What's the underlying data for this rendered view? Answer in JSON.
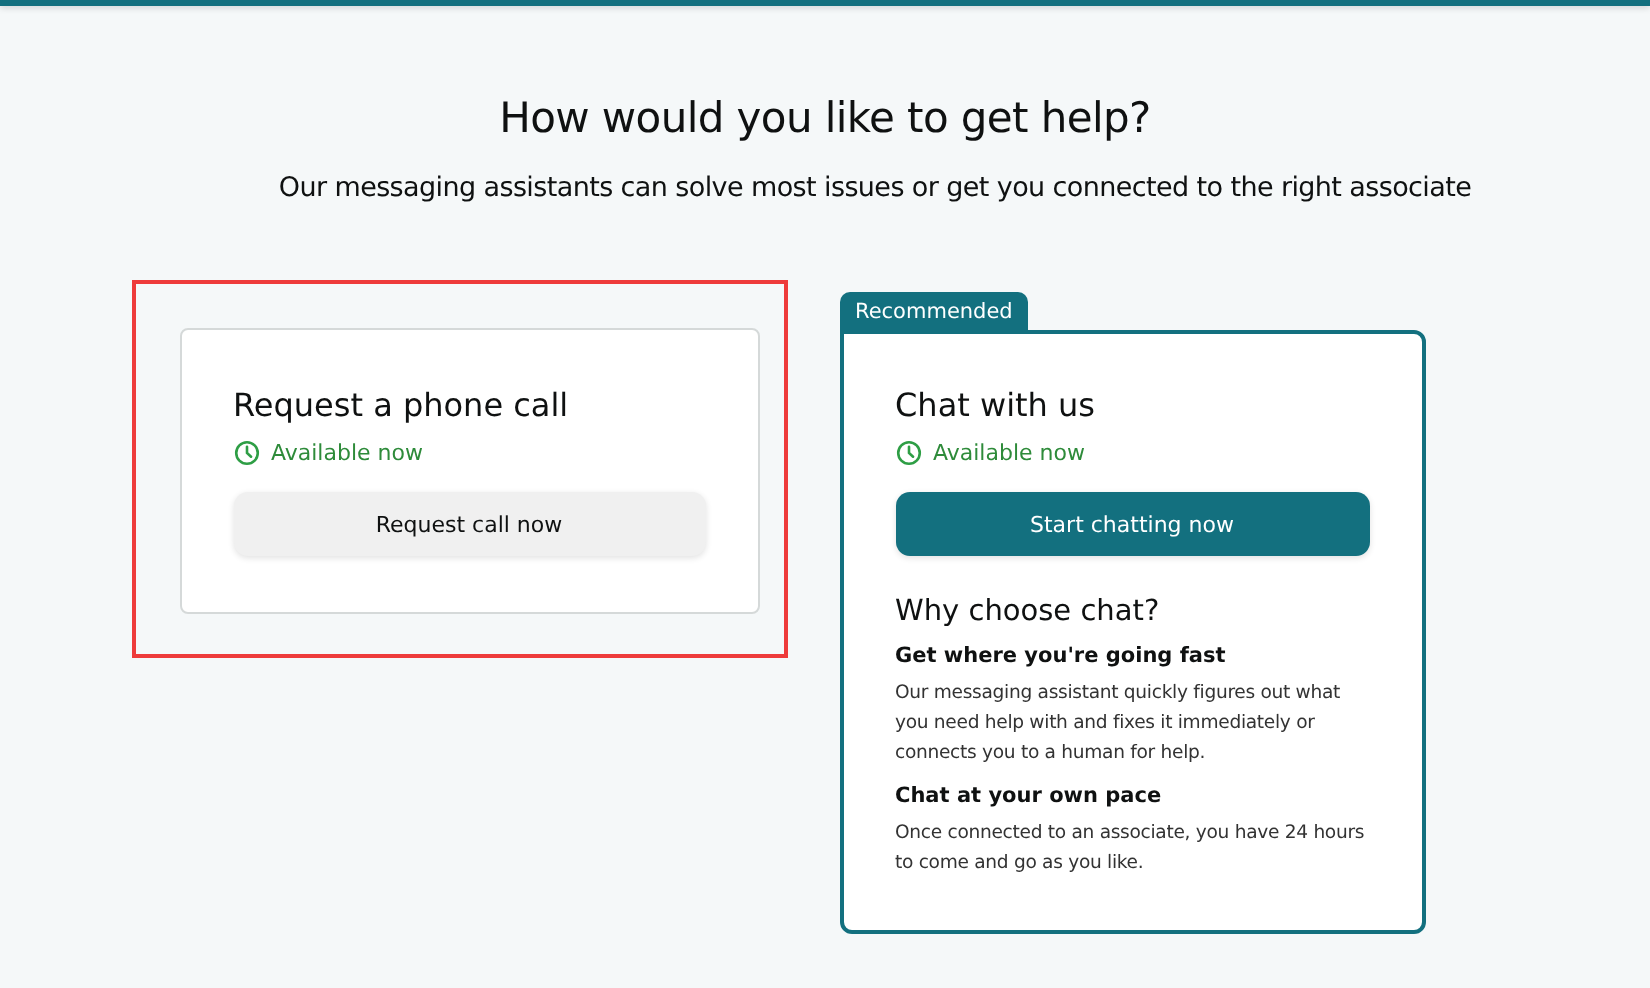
{
  "title": "How would you like to get help?",
  "subtitle": "Our messaging assistants can solve most issues or get you connected to the right associate",
  "options": [
    {
      "kind": "phone",
      "highlighted": true,
      "heading": "Request a phone call",
      "availability": "Available now",
      "button": "Request call now",
      "primary": false
    },
    {
      "kind": "chat",
      "highlighted": false,
      "badge": "Recommended",
      "heading": "Chat with us",
      "availability": "Available now",
      "button": "Start chatting now",
      "primary": true,
      "why": {
        "heading": "Why choose chat?",
        "points": [
          {
            "title": "Get where you're going fast",
            "text": "Our messaging assistant quickly figures out what you need help with and fixes it immediately or connects you to a human for help."
          },
          {
            "title": "Chat at your own pace",
            "text": "Once connected to an associate, you have 24 hours to come and go as you like."
          }
        ]
      }
    }
  ]
}
